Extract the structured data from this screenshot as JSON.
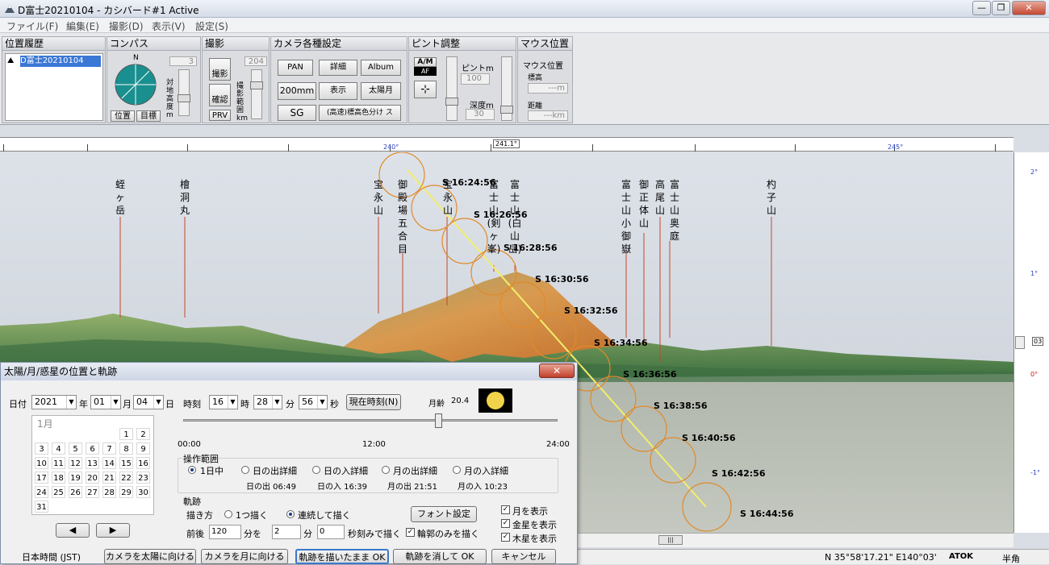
{
  "window": {
    "title": "D富士20210104 - カシバード#1 Active",
    "minimize": "—",
    "restore": "❐",
    "close": "✕"
  },
  "menu": [
    "ファイル(F)",
    "編集(E)",
    "撮影(D)",
    "表示(V)",
    "設定(S)"
  ],
  "toolbar": {
    "history": {
      "header": "位置履歴",
      "item": "D富士20210104"
    },
    "compass": {
      "header": "コンパス",
      "north": "N",
      "value": "3",
      "vlabel": "対地高度m",
      "pos_btn": "位置",
      "target_btn": "目標"
    },
    "shoot": {
      "header": "撮影",
      "value": "204",
      "shoot_btn": "撮影",
      "confirm_btn": "確認",
      "prv_btn": "PRV",
      "vlabel": "撮影範囲km"
    },
    "camera": {
      "header": "カメラ各種設定",
      "buttons": [
        "PAN",
        "詳細",
        "Album",
        "200mm",
        "表示",
        "太陽月",
        "SG",
        "(高速)標高色分け ス"
      ]
    },
    "focus": {
      "header": "ピント調整",
      "am": "A/M",
      "af": "AF",
      "pinto_label": "ピントm",
      "pinto_value": "100",
      "depth_label": "深度m",
      "depth_value": "30"
    },
    "mouse": {
      "header": "マウス位置",
      "pos": "マウス位置",
      "alt_label": "標高",
      "alt_value": "---m",
      "dist_label": "距離",
      "dist_value": "---km"
    }
  },
  "ruler": {
    "marker": "241.1°",
    "label_240": "240°",
    "label_245": "245°"
  },
  "right_ruler": {
    "l1": "2°",
    "l2": "1°",
    "l3": "0°",
    "l4": "-1°",
    "box": "03"
  },
  "mountains": [
    "蛭ヶ岳",
    "檜洞丸",
    "宝永山",
    "御殿場五合目",
    "宝永山",
    "富士山(剣ヶ峯)",
    "富士山(白山岳)",
    "富士山小御嶽",
    "御正体山",
    "高尾山",
    "富士山奥庭",
    "杓子山"
  ],
  "sun_track": [
    "S 16:24:56",
    "S 16:26:56",
    "S 16:28:56",
    "S 16:30:56",
    "S 16:32:56",
    "S 16:34:56",
    "S 16:36:56",
    "S 16:38:56",
    "S 16:40:56",
    "S 16:42:56",
    "S 16:44:56"
  ],
  "dialog": {
    "title": "太陽/月/惑星の位置と軌跡",
    "close": "✕",
    "date_label": "日付",
    "year": "2021",
    "year_unit": "年",
    "month": "01",
    "month_unit": "月",
    "day": "04",
    "day_unit": "日",
    "time_label": "時刻",
    "hour": "16",
    "hour_unit": "時",
    "minute": "28",
    "minute_unit": "分",
    "second": "56",
    "second_unit": "秒",
    "now_btn": "現在時刻(N)",
    "moon_age_label": "月齢",
    "moon_age": "20.4",
    "cal_month": "1月",
    "cal_days": [
      [
        "",
        "",
        "",
        "",
        "",
        "1",
        "2"
      ],
      [
        "3",
        "4",
        "5",
        "6",
        "7",
        "8",
        "9"
      ],
      [
        "10",
        "11",
        "12",
        "13",
        "14",
        "15",
        "16"
      ],
      [
        "17",
        "18",
        "19",
        "20",
        "21",
        "22",
        "23"
      ],
      [
        "24",
        "25",
        "26",
        "27",
        "28",
        "29",
        "30"
      ],
      [
        "31",
        "",
        "",
        "",
        "",
        "",
        ""
      ]
    ],
    "prev_btn": "◀",
    "next_btn": "▶",
    "scale": [
      "00:00",
      "12:00",
      "24:00"
    ],
    "range_label": "操作範囲",
    "range_opts": [
      "1日中",
      "日の出詳細",
      "日の入詳細",
      "月の出詳細",
      "月の入詳細"
    ],
    "sunrise": "日の出 06:49",
    "sunset": "日の入 16:39",
    "moonrise": "月の出 21:51",
    "moonset": "月の入 10:23",
    "track_label": "軌跡",
    "draw_label": "描き方",
    "draw_opt1": "1つ描く",
    "draw_opt2": "連続して描く",
    "font_btn": "フォント設定",
    "before_after": "前後",
    "ba_value": "120",
    "ba_unit": "分を",
    "step_value": "2",
    "step_unit": "分",
    "offset_value": "0",
    "offset_unit": "秒刻みで描く",
    "outline_only": "輪郭のみを描く",
    "show_moon": "月を表示",
    "show_venus": "金星を表示",
    "show_jupiter": "木星を表示",
    "tz": "日本時間 (JST)",
    "b1": "カメラを太陽に向ける",
    "b2": "カメラを月に向ける",
    "b3": "軌跡を描いたまま OK",
    "b4": "軌跡を消して OK",
    "b5": "キャンセル"
  },
  "status": {
    "coord": "N 35°58'17.21\"  E140°03'",
    "atok": "ATOK",
    "mode": "半角",
    "scroll_thumb": "|||"
  }
}
